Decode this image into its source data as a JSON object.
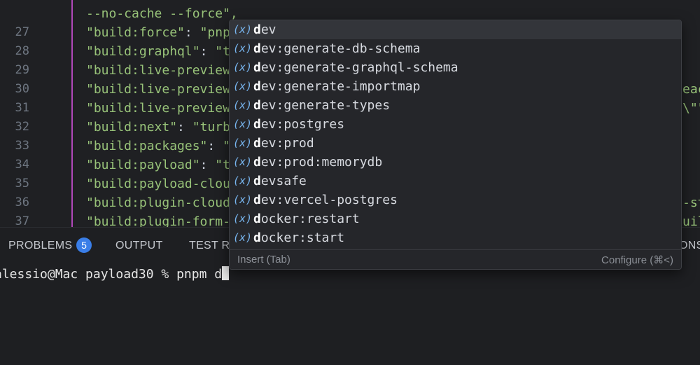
{
  "editor": {
    "top_fragment": "--no-cache --force\",",
    "lines": [
      {
        "num": "27",
        "key": "\"build:force\"",
        "value": "\"pnp"
      },
      {
        "num": "28",
        "key": "\"build:graphql\"",
        "value": "\"t"
      },
      {
        "num": "29",
        "key": "\"build:live-preview",
        "value": ""
      },
      {
        "num": "30",
        "key": "\"build:live-preview",
        "value": "",
        "right": "eac"
      },
      {
        "num": "31",
        "key": "\"build:live-preview",
        "value": "",
        "right": "\\\"\""
      },
      {
        "num": "32",
        "key": "\"build:next\"",
        "value": "\"turb"
      },
      {
        "num": "33",
        "key": "\"build:packages\"",
        "value": "\""
      },
      {
        "num": "34",
        "key": "\"build:payload\"",
        "value": "\"t"
      },
      {
        "num": "35",
        "key": "\"build:payload-clou",
        "value": ""
      },
      {
        "num": "36",
        "key": "\"build:plugin-cloud",
        "value": "",
        "right": "-st"
      },
      {
        "num": "37",
        "key": "\"build:plugin-form-",
        "value": "",
        "right": "uil"
      }
    ]
  },
  "panel": {
    "tabs": [
      {
        "label": "PROBLEMS"
      },
      {
        "label": "OUTPUT"
      },
      {
        "label": "TEST R"
      },
      {
        "label": "ONS"
      }
    ],
    "problems_count": "5"
  },
  "terminal": {
    "prompt": "alessio@Mac payload30 % pnpm d"
  },
  "suggestions": {
    "icon_text": "(x)",
    "typed": "d",
    "items": [
      {
        "match": "d",
        "rest": "ev"
      },
      {
        "match": "d",
        "rest": "ev:generate-db-schema"
      },
      {
        "match": "d",
        "rest": "ev:generate-graphql-schema"
      },
      {
        "match": "d",
        "rest": "ev:generate-importmap"
      },
      {
        "match": "d",
        "rest": "ev:generate-types"
      },
      {
        "match": "d",
        "rest": "ev:postgres"
      },
      {
        "match": "d",
        "rest": "ev:prod"
      },
      {
        "match": "d",
        "rest": "ev:prod:memorydb"
      },
      {
        "match": "d",
        "rest": "evsafe"
      },
      {
        "match": "d",
        "rest": "ev:vercel-postgres"
      },
      {
        "match": "d",
        "rest": "ocker:restart"
      },
      {
        "match": "d",
        "rest": "ocker:start"
      }
    ],
    "footer_left": "Insert (Tab)",
    "footer_right": "Configure (⌘<)"
  },
  "colors": {
    "accent": "#3a7ee8",
    "string": "#98c379",
    "icon": "#78b6f0",
    "indent_guide": "#b048b9"
  }
}
